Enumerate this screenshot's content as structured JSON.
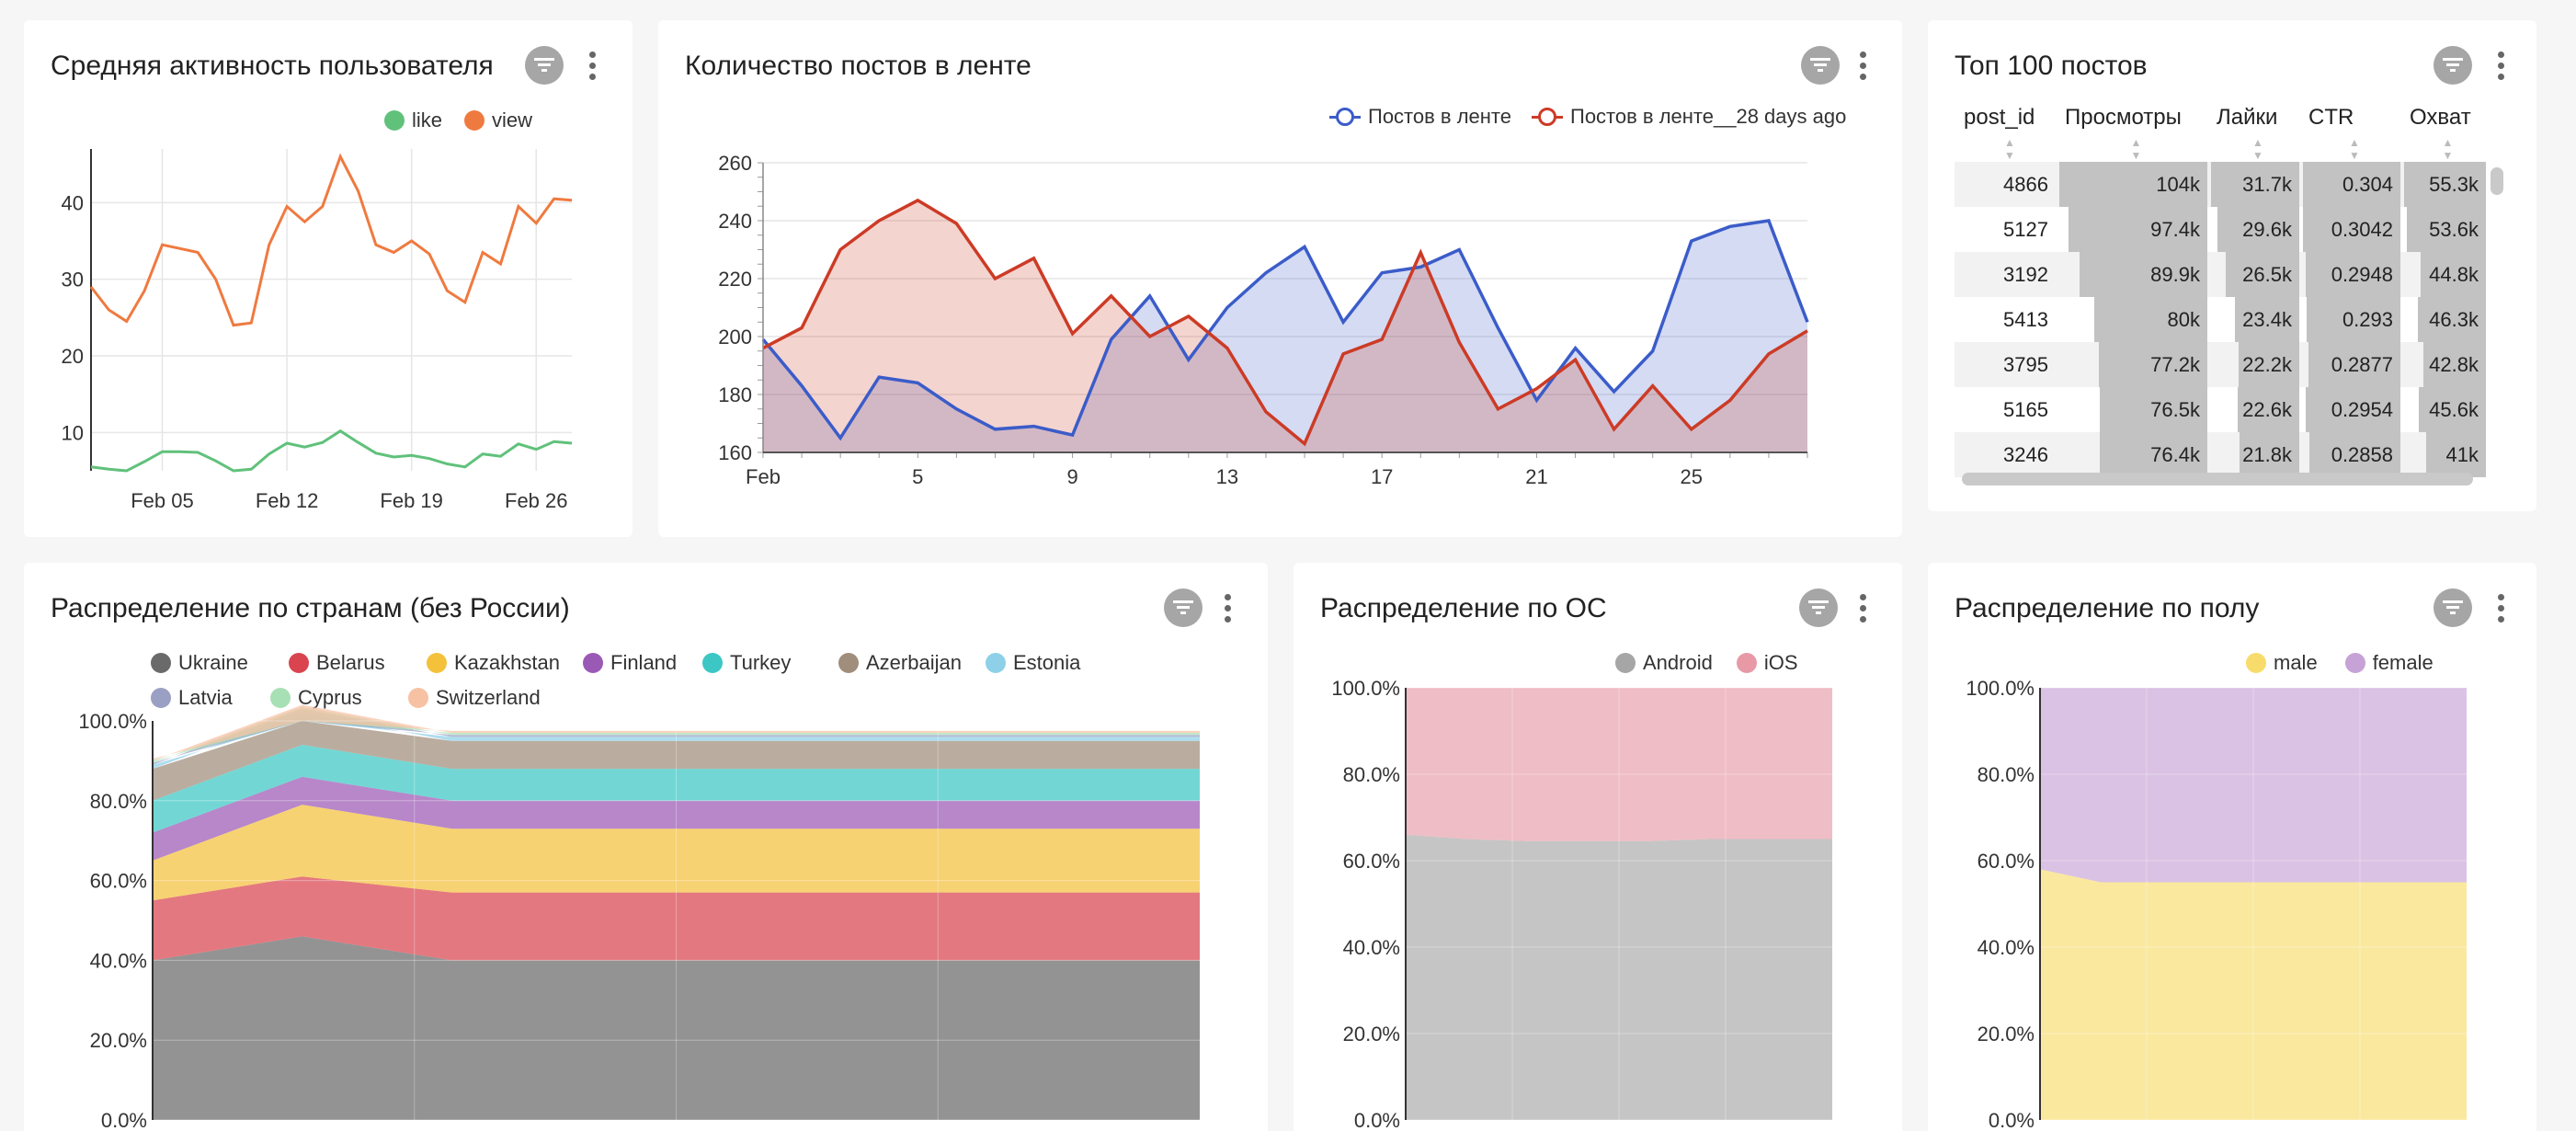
{
  "colors": {
    "view": "#ef7a40",
    "like": "#60c17b",
    "blue": "#3b5cc9",
    "red": "#cc3b26"
  },
  "cards": {
    "activity": {
      "title": "Средняя активность пользователя",
      "legend": [
        {
          "name": "like",
          "color": "#60c17b"
        },
        {
          "name": "view",
          "color": "#ef7a40"
        }
      ]
    },
    "feed": {
      "title": "Количество постов в ленте",
      "legend": [
        {
          "name": "Постов в ленте",
          "color": "#3b5cc9"
        },
        {
          "name": "Постов в ленте__28 days ago",
          "color": "#cc3b26"
        }
      ]
    },
    "top": {
      "title": "Топ 100 постов",
      "columns": [
        "post_id",
        "Просмотры",
        "Лайки",
        "CTR",
        "Охват"
      ],
      "rows": [
        {
          "post_id": "4866",
          "views": "104k",
          "likes": "31.7k",
          "ctr": "0.304",
          "reach": "55.3k"
        },
        {
          "post_id": "5127",
          "views": "97.4k",
          "likes": "29.6k",
          "ctr": "0.3042",
          "reach": "53.6k"
        },
        {
          "post_id": "3192",
          "views": "89.9k",
          "likes": "26.5k",
          "ctr": "0.2948",
          "reach": "44.8k"
        },
        {
          "post_id": "5413",
          "views": "80k",
          "likes": "23.4k",
          "ctr": "0.293",
          "reach": "46.3k"
        },
        {
          "post_id": "3795",
          "views": "77.2k",
          "likes": "22.2k",
          "ctr": "0.2877",
          "reach": "42.8k"
        },
        {
          "post_id": "5165",
          "views": "76.5k",
          "likes": "22.6k",
          "ctr": "0.2954",
          "reach": "45.6k"
        },
        {
          "post_id": "3246",
          "views": "76.4k",
          "likes": "21.8k",
          "ctr": "0.2858",
          "reach": "41k"
        }
      ]
    },
    "countries": {
      "title": "Распределение по странам (без России)",
      "legend": [
        {
          "name": "Ukraine",
          "color": "#6a6a6a"
        },
        {
          "name": "Belarus",
          "color": "#d9444f"
        },
        {
          "name": "Kazakhstan",
          "color": "#f4c13b"
        },
        {
          "name": "Finland",
          "color": "#9b59b6"
        },
        {
          "name": "Turkey",
          "color": "#3cc7c4"
        },
        {
          "name": "Azerbaijan",
          "color": "#a08d7b"
        },
        {
          "name": "Estonia",
          "color": "#8ed0e8"
        },
        {
          "name": "Latvia",
          "color": "#9aa0c4"
        },
        {
          "name": "Cyprus",
          "color": "#a8e0b5"
        },
        {
          "name": "Switzerland",
          "color": "#f7c1a3"
        }
      ]
    },
    "os": {
      "title": "Распределение по ОС",
      "legend": [
        {
          "name": "Android",
          "color": "#a6a6a6"
        },
        {
          "name": "iOS",
          "color": "#e79aa6"
        }
      ]
    },
    "gender": {
      "title": "Распределение по полу",
      "legend": [
        {
          "name": "male",
          "color": "#f8dc6b"
        },
        {
          "name": "female",
          "color": "#c6a2d6"
        }
      ]
    }
  },
  "chart_data": [
    {
      "id": "activity",
      "type": "line",
      "x_ticks": [
        "Feb 05",
        "Feb 12",
        "Feb 19",
        "Feb 26"
      ],
      "ylim": [
        5,
        47
      ],
      "y_ticks": [
        10,
        20,
        30,
        40
      ],
      "grid": true,
      "series": [
        {
          "name": "view",
          "values": [
            29,
            26,
            24.5,
            28.5,
            34.5,
            34,
            33.5,
            30,
            24,
            24.3,
            34.5,
            39.5,
            37.5,
            39.5,
            46,
            41.5,
            34.5,
            33.5,
            35,
            33.3,
            28.5,
            27,
            33.5,
            32,
            39.5,
            37.3,
            40.5,
            40.3
          ]
        },
        {
          "name": "like",
          "values": [
            5.5,
            5.2,
            5,
            6.2,
            7.5,
            7.5,
            7.4,
            6.3,
            5,
            5.2,
            7.2,
            8.6,
            8.1,
            8.7,
            10.2,
            8.7,
            7.3,
            6.8,
            7,
            6.6,
            5.9,
            5.5,
            7.2,
            6.9,
            8.5,
            7.8,
            8.8,
            8.6
          ]
        }
      ]
    },
    {
      "id": "feed",
      "type": "area",
      "x_ticks": [
        "Feb",
        "5",
        "9",
        "13",
        "17",
        "21",
        "25"
      ],
      "ylim": [
        160,
        260
      ],
      "y_ticks": [
        160,
        180,
        200,
        220,
        240,
        260
      ],
      "grid": true,
      "series": [
        {
          "name": "Постов в ленте",
          "values": [
            199,
            183,
            165,
            186,
            184,
            175,
            168,
            169,
            166,
            199,
            214,
            192,
            210,
            222,
            231,
            205,
            222,
            224,
            230,
            203,
            178,
            196,
            181,
            195,
            233,
            238,
            240,
            205
          ]
        },
        {
          "name": "Постов в ленте__28 days ago",
          "values": [
            196,
            203,
            230,
            240,
            247,
            239,
            220,
            227,
            201,
            214,
            200,
            207,
            196,
            174,
            163,
            194,
            199,
            229,
            198,
            175,
            182,
            192,
            168,
            183,
            168,
            178,
            194,
            202
          ]
        }
      ]
    },
    {
      "id": "countries",
      "type": "area",
      "stacked": true,
      "ylim": [
        0,
        100
      ],
      "y_ticks": [
        "0.0%",
        "20.0%",
        "40.0%",
        "60.0%",
        "80.0%",
        "100.0%"
      ],
      "series": [
        {
          "name": "Ukraine",
          "values": [
            40,
            46,
            40,
            40,
            40,
            40,
            40,
            40
          ]
        },
        {
          "name": "Belarus",
          "values": [
            15,
            15,
            17,
            17,
            17,
            17,
            17,
            17
          ]
        },
        {
          "name": "Kazakhstan",
          "values": [
            10,
            18,
            16,
            16,
            16,
            16,
            16,
            16
          ]
        },
        {
          "name": "Finland",
          "values": [
            7,
            7,
            7,
            7,
            7,
            7,
            7,
            7
          ]
        },
        {
          "name": "Turkey",
          "values": [
            8,
            8,
            8,
            8,
            8,
            8,
            8,
            8
          ]
        },
        {
          "name": "Azerbaijan",
          "values": [
            8,
            8,
            7,
            7,
            7,
            7,
            7,
            7
          ]
        },
        {
          "name": "Estonia",
          "values": [
            1,
            1,
            1,
            1,
            1,
            1,
            1,
            1
          ]
        },
        {
          "name": "Latvia",
          "values": [
            0.5,
            0.5,
            0.5,
            0.5,
            0.5,
            0.5,
            0.5,
            0.5
          ]
        },
        {
          "name": "Cyprus",
          "values": [
            0.5,
            0.5,
            0.5,
            0.5,
            0.5,
            0.5,
            0.5,
            0.5
          ]
        },
        {
          "name": "Switzerland",
          "values": [
            0.5,
            0.5,
            0.5,
            0.5,
            0.5,
            0.5,
            0.5,
            0.5
          ]
        }
      ]
    },
    {
      "id": "os",
      "type": "area",
      "stacked": true,
      "ylim": [
        0,
        100
      ],
      "y_ticks": [
        "0.0%",
        "20.0%",
        "40.0%",
        "60.0%",
        "80.0%",
        "100.0%"
      ],
      "series": [
        {
          "name": "Android",
          "values": [
            66,
            65,
            64.5,
            64.5,
            64.5,
            65,
            65,
            65
          ]
        },
        {
          "name": "iOS",
          "values": [
            34,
            35,
            35.5,
            35.5,
            35.5,
            35,
            35,
            35
          ]
        }
      ]
    },
    {
      "id": "gender",
      "type": "area",
      "stacked": true,
      "ylim": [
        0,
        100
      ],
      "y_ticks": [
        "0.0%",
        "20.0%",
        "40.0%",
        "60.0%",
        "80.0%",
        "100.0%"
      ],
      "series": [
        {
          "name": "male",
          "values": [
            58,
            55,
            55,
            55,
            55,
            55,
            55,
            55
          ]
        },
        {
          "name": "female",
          "values": [
            42,
            45,
            45,
            45,
            45,
            45,
            45,
            45
          ]
        }
      ]
    }
  ]
}
